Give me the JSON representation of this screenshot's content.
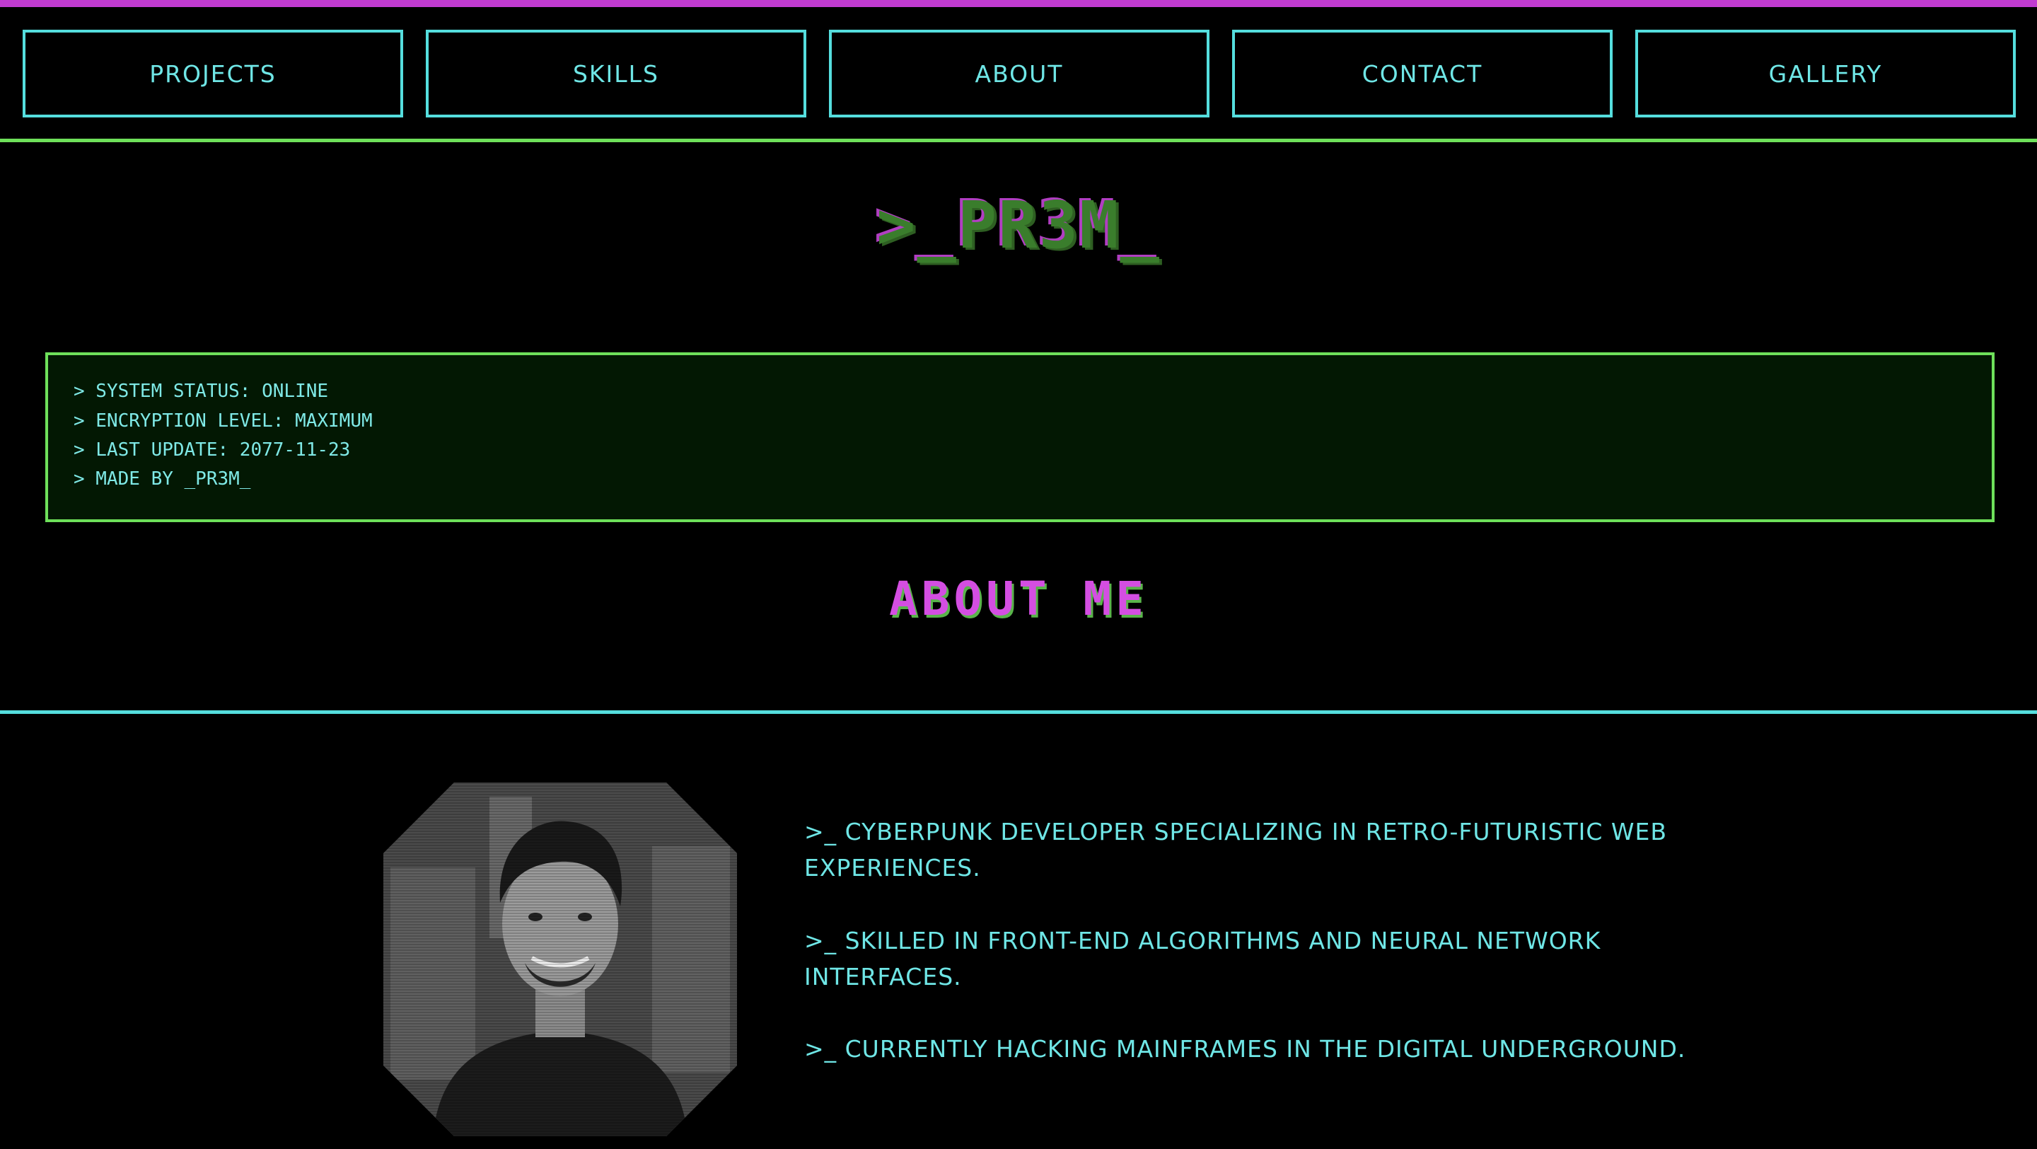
{
  "nav": {
    "items": [
      {
        "label": "PROJECTS"
      },
      {
        "label": "SKILLS"
      },
      {
        "label": "ABOUT"
      },
      {
        "label": "CONTACT"
      },
      {
        "label": "GALLERY"
      }
    ]
  },
  "logo": {
    "text": ">_PR3M_"
  },
  "status": {
    "lines": [
      "> SYSTEM STATUS: ONLINE",
      "> ENCRYPTION LEVEL: MAXIMUM",
      "> LAST UPDATE: 2077-11-23",
      "> MADE BY _PR3M_"
    ]
  },
  "about": {
    "title": "ABOUT ME",
    "paragraphs": [
      ">_ CYBERPUNK DEVELOPER SPECIALIZING IN RETRO-FUTURISTIC WEB EXPERIENCES.",
      ">_ SKILLED IN FRONT-END ALGORITHMS AND NEURAL NETWORK INTERFACES.",
      ">_ CURRENTLY HACKING MAINFRAMES IN THE DIGITAL UNDERGROUND."
    ]
  },
  "colors": {
    "background": "#000000",
    "cyan": "#55dede",
    "green": "#6ee05a",
    "magenta": "#c13bd0"
  }
}
